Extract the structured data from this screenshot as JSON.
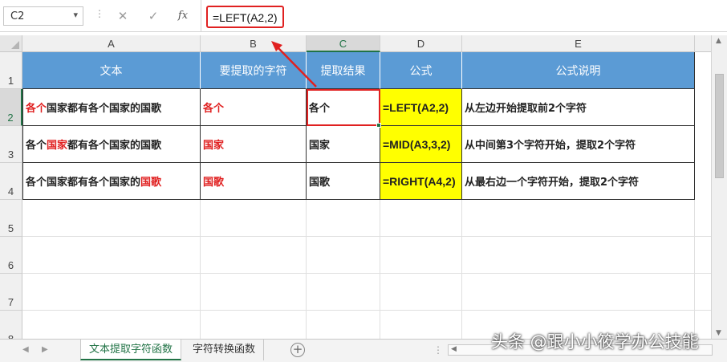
{
  "formula_bar": {
    "name_box": "C2",
    "cancel_icon": "✕",
    "enter_icon": "✓",
    "fx_label": "fx",
    "formula": "=LEFT(A2,2)"
  },
  "columns": [
    "A",
    "B",
    "C",
    "D",
    "E"
  ],
  "rows": [
    "1",
    "2",
    "3",
    "4",
    "5",
    "6",
    "7",
    "8"
  ],
  "table": {
    "headers": [
      "文本",
      "要提取的字符",
      "提取结果",
      "公式",
      "公式说明"
    ],
    "rows": [
      {
        "text_pre": "",
        "text_red": "各个",
        "text_post": "国家都有各个国家的国歌",
        "extract": "各个",
        "result": "各个",
        "formula": "=LEFT(A2,2)",
        "desc": "从左边开始提取前2个字符"
      },
      {
        "text_pre": "各个",
        "text_red": "国家",
        "text_post": "都有各个国家的国歌",
        "extract": "国家",
        "result": "国家",
        "formula": "=MID(A3,3,2)",
        "desc": "从中间第3个字符开始，提取2个字符"
      },
      {
        "text_pre": "各个国家都有各个国家的",
        "text_red": "国歌",
        "text_post": "",
        "extract": "国歌",
        "result": "国歌",
        "formula": "=RIGHT(A4,2)",
        "desc": "从最右边一个字符开始，提取2个字符"
      }
    ]
  },
  "sheets": [
    "文本提取字符函数",
    "字符转换函数"
  ],
  "add_sheet": "⊕",
  "watermark": "头条 @跟小小筱学办公技能",
  "colors": {
    "header_fill": "#5b9bd5",
    "formula_fill": "#ffff00",
    "highlight_red": "#e02020",
    "excel_green": "#217346"
  }
}
